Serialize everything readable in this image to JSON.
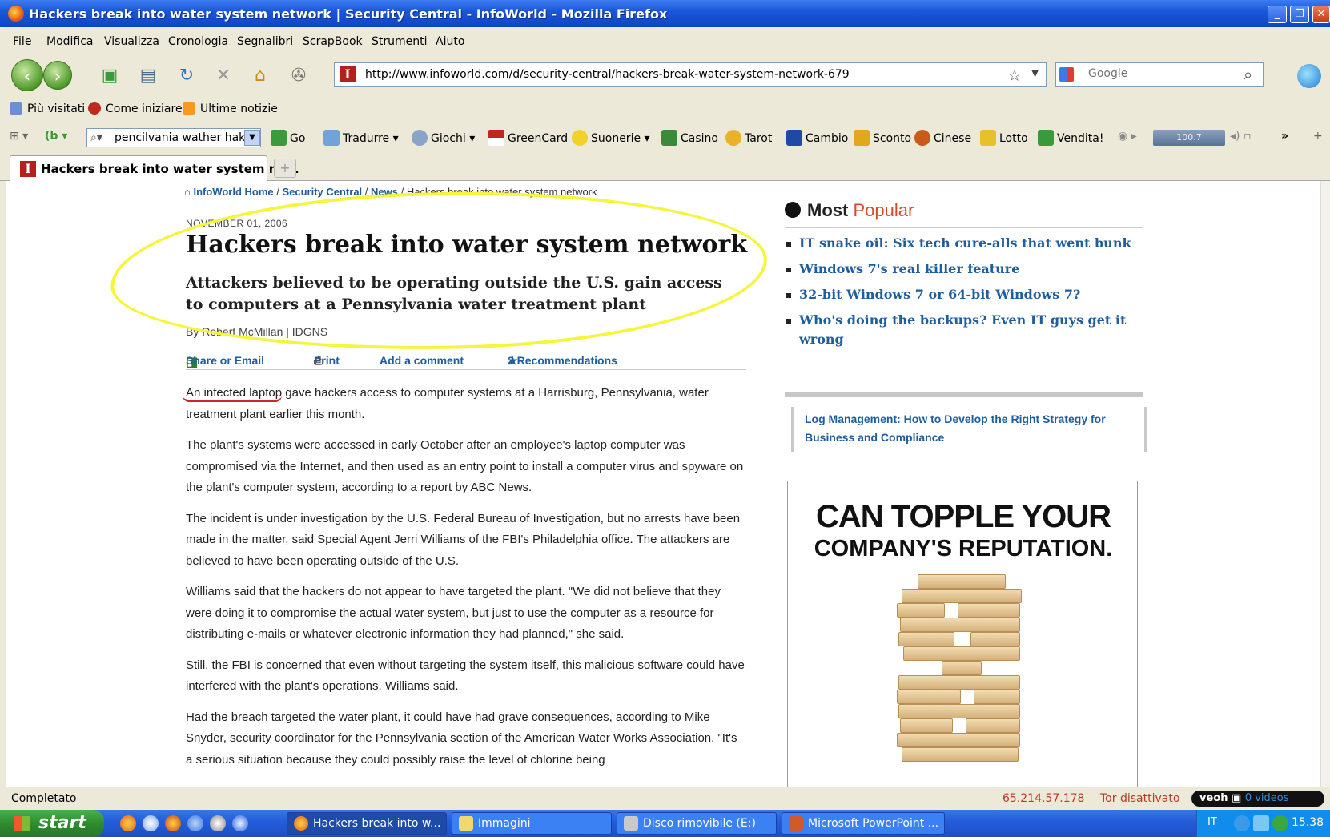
{
  "window": {
    "title": "Hackers break into water system network | Security Central - InfoWorld - Mozilla Firefox",
    "controls": {
      "minimize": "_",
      "maximize": "❐",
      "close": "✕"
    }
  },
  "menu": [
    "File",
    "Modifica",
    "Visualizza",
    "Cronologia",
    "Segnalibri",
    "ScrapBook",
    "Strumenti",
    "Aiuto"
  ],
  "nav": {
    "back": "‹",
    "forward": "›",
    "url": "http://www.infoworld.com/d/security-central/hackers-break-water-system-network-679",
    "site_icon_letter": "I",
    "search_placeholder": "Google"
  },
  "bookmarks": [
    "Più visitati",
    "Come iniziare",
    "Ultime notizie"
  ],
  "toolbar": {
    "search_value": "pencilvania wather haker",
    "go": "Go",
    "items": [
      "Tradurre",
      "Giochi",
      "GreenCard",
      "Suonerie",
      "Casino",
      "Tarot",
      "Cambio",
      "Sconto",
      "Cinese",
      "Lotto",
      "Vendita!"
    ],
    "volume": "100.7",
    "overflow": "»"
  },
  "tab": {
    "active_label": "Hackers break into water system ne...",
    "new_tab": "+"
  },
  "article": {
    "breadcrumb": {
      "home": "InfoWorld Home",
      "section": "Security Central",
      "category": "News",
      "current": "/ Hackers break into water system network",
      "sep1": " / ",
      "sep2": " / "
    },
    "date": "NOVEMBER 01, 2006",
    "headline": "Hackers break into water system network",
    "dek": "Attackers believed to be operating outside the U.S. gain access to computers at a Pennsylvania water treatment plant",
    "byline": "By Robert McMillan | IDGNS",
    "actions": {
      "share": "Share or Email",
      "print": "Print",
      "comment": "Add a comment",
      "recommend": "2 Recommendations"
    },
    "paragraphs": [
      "An infected laptop gave hackers access to computer systems at a Harrisburg, Pennsylvania, water treatment plant earlier this month.",
      "The plant's systems were accessed in early October after an employee's laptop computer was compromised via the Internet, and then used as an entry point to install a computer virus and spyware on the plant's computer system, according to a report by ABC News.",
      "The incident is under investigation by the U.S. Federal Bureau of Investigation, but no arrests have been made in the matter, said Special Agent Jerri Williams of the FBI's Philadelphia office. The attackers are believed to have been operating outside of the U.S.",
      "Williams said that the hackers do not appear to have targeted the plant. \"We did not believe that they were doing it to compromise the actual water system, but just to use the computer as a resource for distributing e-mails or whatever electronic information they had planned,\" she said.",
      "Still, the FBI is concerned that even without targeting the system itself, this malicious software could have interfered with the plant's operations, Williams said.",
      "Had the breach targeted the water plant, it could have had grave consequences, according to Mike Snyder, security coordinator for the Pennsylvania section of the American Water Works Association. \"It's a serious situation because they could possibly raise the level of chlorine being"
    ]
  },
  "sidebar": {
    "popular_title_a": "Most",
    "popular_title_b": "Popular",
    "popular": [
      "IT snake oil: Six tech cure-alls that went bunk",
      "Windows 7's real killer feature",
      "32-bit Windows 7 or 64-bit Windows 7?",
      "Who's doing the backups? Even IT guys get it wrong"
    ],
    "promo": "Log Management: How to Develop the Right Strategy for Business and Compliance",
    "ad": {
      "line1": "CAN TOPPLE YOUR",
      "line2": "COMPANY'S REPUTATION."
    }
  },
  "status": {
    "text": "Completato",
    "ip": "65.214.57.178",
    "tor": "Tor disattivato",
    "veoh": "veoh",
    "veoh_videos": "0 videos"
  },
  "taskbar": {
    "start": "start",
    "items": [
      "Hackers break into w...",
      "Immagini",
      "Disco rimovibile (E:)",
      "Microsoft PowerPoint ..."
    ],
    "lang": "IT",
    "clock": "15.38"
  },
  "colors": {
    "link": "#1f5d9e",
    "highlight": "#f5f53a",
    "underline": "#d2242a",
    "popular_accent": "#d54a2b"
  }
}
